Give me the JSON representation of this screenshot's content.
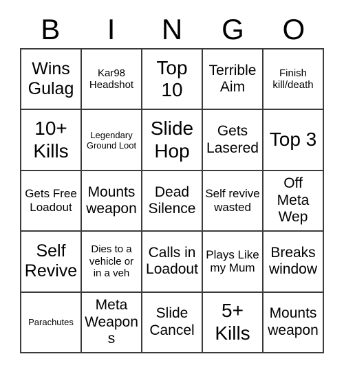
{
  "card": {
    "header_letters": [
      "B",
      "I",
      "N",
      "G",
      "O"
    ],
    "grid_size": "5x5",
    "colors": {
      "background": "#ffffff",
      "grid_line": "#3b3b3b",
      "text": "#000000"
    },
    "rows": [
      [
        {
          "text": "Wins Gulag",
          "size": "lg"
        },
        {
          "text": "Kar98 Headshot",
          "size": "xs"
        },
        {
          "text": "Top 10",
          "size": "xl"
        },
        {
          "text": "Terrible Aim",
          "size": "md"
        },
        {
          "text": "Finish kill/death",
          "size": "xs"
        }
      ],
      [
        {
          "text": "10+ Kills",
          "size": "xl"
        },
        {
          "text": "Legendary Ground Loot",
          "size": "xxs"
        },
        {
          "text": "Slide Hop",
          "size": "xl"
        },
        {
          "text": "Gets Lasered",
          "size": "md"
        },
        {
          "text": "Top 3",
          "size": "xl"
        }
      ],
      [
        {
          "text": "Gets Free Loadout",
          "size": "sm"
        },
        {
          "text": "Mounts weapon",
          "size": "md"
        },
        {
          "text": "Dead Silence",
          "size": "md"
        },
        {
          "text": "Self revive wasted",
          "size": "sm"
        },
        {
          "text": "Off Meta Wep",
          "size": "md"
        }
      ],
      [
        {
          "text": "Self Revive",
          "size": "lg"
        },
        {
          "text": "Dies to a vehicle or in a veh",
          "size": "xs"
        },
        {
          "text": "Calls in Loadout",
          "size": "md"
        },
        {
          "text": "Plays Like my Mum",
          "size": "sm"
        },
        {
          "text": "Breaks window",
          "size": "md"
        }
      ],
      [
        {
          "text": "Parachutes",
          "size": "xxs"
        },
        {
          "text": "Meta Weapons",
          "size": "md"
        },
        {
          "text": "Slide Cancel",
          "size": "md"
        },
        {
          "text": "5+ Kills",
          "size": "xl"
        },
        {
          "text": "Mounts weapon",
          "size": "md"
        }
      ]
    ]
  }
}
